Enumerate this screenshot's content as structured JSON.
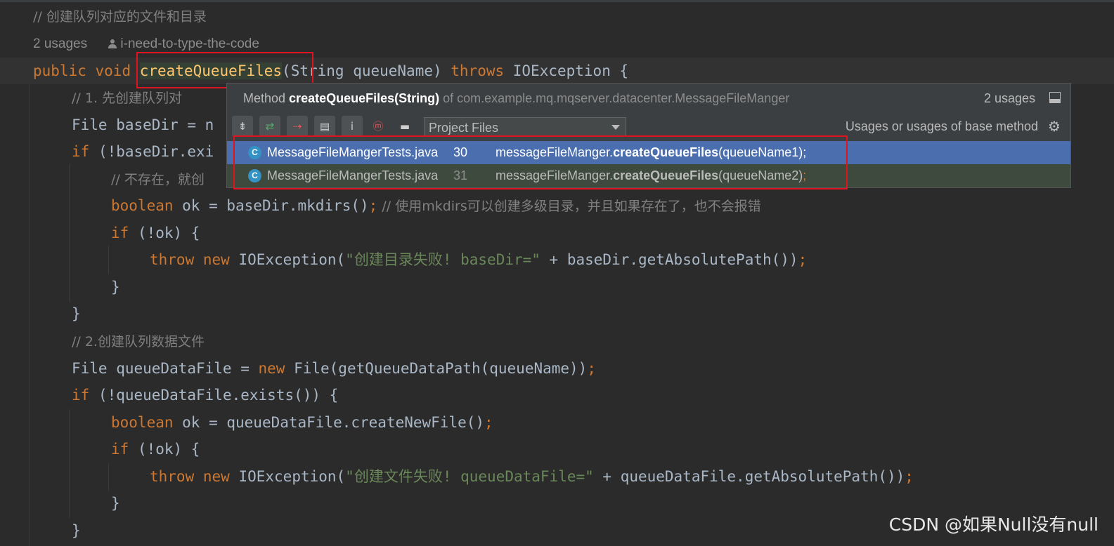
{
  "inlay": {
    "usages": "2 usages",
    "author": "i-need-to-type-the-code"
  },
  "code": {
    "l0": "// 创建队列对应的文件和目录",
    "sig_public": "public",
    "sig_void": "void",
    "sig_name": "createQueueFiles",
    "sig_params": "(String queueName) ",
    "sig_throws": "throws",
    "sig_rest": " IOException {",
    "l2": "// 1. 先创建队列对",
    "l3": "File baseDir = n",
    "l4_kw": "if",
    "l4": " (!baseDir.exi",
    "l5": "// 不存在，就创",
    "l6_kw": "boolean",
    "l6": " ok = baseDir.mkdirs()",
    "l6_cm": " // 使用mkdirs可以创建多级目录，并且如果存在了，也不会报错",
    "l7_kw": "if",
    "l7": " (!ok) {",
    "l8_throw": "throw",
    "l8_new": "new",
    "l8_a": " IOException(",
    "l8_str": "\"创建目录失败! baseDir=\"",
    "l8_b": " + baseDir.getAbsolutePath())",
    "l9": "}",
    "l10": "}",
    "l11": "// 2.创建队列数据文件",
    "l12_a": "File queueDataFile = ",
    "l12_new": "new",
    "l12_b": " File(getQueueDataPath(queueName))",
    "l13_kw": "if",
    "l13": " (!queueDataFile.exists()) {",
    "l14_kw": "boolean",
    "l14": " ok = queueDataFile.createNewFile()",
    "l15_kw": "if",
    "l15": " (!ok) {",
    "l16_throw": "throw",
    "l16_new": "new",
    "l16_a": " IOException(",
    "l16_str": "\"创建文件失败! queueDataFile=\"",
    "l16_b": " + queueDataFile.getAbsolutePath())",
    "l17": "}",
    "l18": "}",
    "semi": ";"
  },
  "popup": {
    "method_prefix": "Method ",
    "method_sig": "createQueueFiles(String)",
    "method_of": " of com.example.mq.mqserver.datacenter.MessageFileManger",
    "count": "2 usages",
    "scope": "Project Files",
    "usage_label": "Usages or usages of base method",
    "results": [
      {
        "file": "MessageFileMangerTests.java",
        "line": "30",
        "pre": "messageFileManger.",
        "call": "createQueueFiles",
        "post": "(queueName1);"
      },
      {
        "file": "MessageFileMangerTests.java",
        "line": "31",
        "pre": "messageFileManger.",
        "call": "createQueueFiles",
        "post": "(queueName2)"
      }
    ]
  },
  "watermark": "CSDN @如果Null没有null",
  "colors": {
    "keyword": "#cc7832",
    "function": "#ffc66d",
    "string": "#6a8759",
    "selection": "#4b6eaf",
    "highlight": "#e0141e"
  }
}
